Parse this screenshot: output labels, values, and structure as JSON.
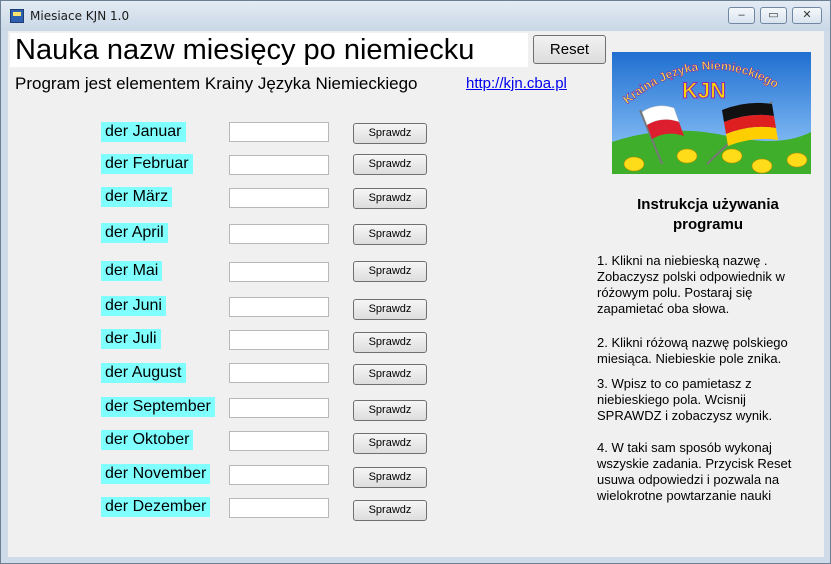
{
  "window": {
    "title": "Miesiace KJN 1.0",
    "buttons": [
      "–",
      "▭",
      "✕"
    ]
  },
  "header": {
    "title": "Nauka nazw miesięcy po niemiecku",
    "reset_label": "Reset",
    "subtitle": "Program jest elementem Krainy Języka Niemieckiego",
    "link": "http://kjn.cba.pl"
  },
  "months": [
    {
      "label": "der Januar",
      "value": "",
      "button": "Sprawdz"
    },
    {
      "label": "der Februar",
      "value": "",
      "button": "Sprawdz"
    },
    {
      "label": "der März",
      "value": "",
      "button": "Sprawdz"
    },
    {
      "label": "der April",
      "value": "",
      "button": "Sprawdz"
    },
    {
      "label": "der Mai",
      "value": "",
      "button": "Sprawdz"
    },
    {
      "label": "der Juni",
      "value": "",
      "button": "Sprawdz"
    },
    {
      "label": "der Juli",
      "value": "",
      "button": "Sprawdz"
    },
    {
      "label": "der August",
      "value": "",
      "button": "Sprawdz"
    },
    {
      "label": "der September",
      "value": "",
      "button": "Sprawdz"
    },
    {
      "label": "der Oktober",
      "value": "",
      "button": "Sprawdz"
    },
    {
      "label": "der November",
      "value": "",
      "button": "Sprawdz"
    },
    {
      "label": "der Dezember",
      "value": "",
      "button": "Sprawdz"
    }
  ],
  "logo": {
    "text_arc": "Kraina Języka Niemieckiego",
    "abbr": "KJN"
  },
  "instructions": {
    "title": "Instrukcja używania programu",
    "steps": [
      "1. Klikni na niebieską nazwę . Zobaczysz polski odpowiednik w różowym polu. Postaraj się zapamietać oba słowa.",
      "2. Klikni różową nazwę polskiego miesiąca. Niebieskie pole znika.",
      "3. Wpisz to co pamietasz z niebieskiego pola. Wcisnij SPRAWDZ i zobaczysz wynik.",
      "4.  W taki sam sposób wykonaj wszyskie zadania. Przycisk Reset usuwa odpowiedzi i pozwala na wielokrotne powtarzanie nauki"
    ]
  },
  "colors": {
    "month_label_bg": "#80ffff",
    "link": "#0000ee",
    "logo_sky": "#3b8fe0",
    "logo_grass": "#3fae2a"
  }
}
